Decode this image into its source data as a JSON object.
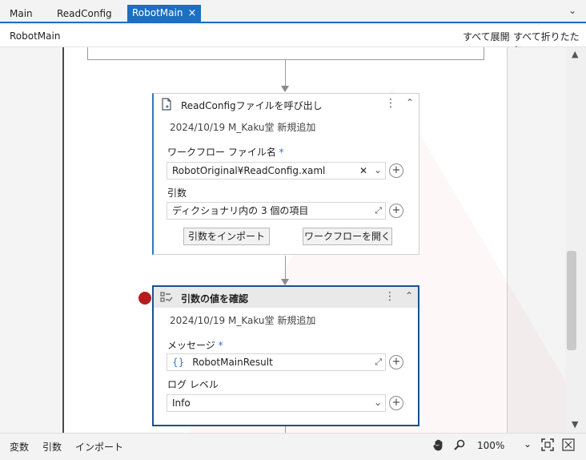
{
  "tabs": [
    {
      "label": "Main"
    },
    {
      "label": "ReadConfig"
    },
    {
      "label": "RobotMain",
      "close_icon": "×"
    }
  ],
  "tab_menu_icon": "⌄",
  "header": {
    "title": "RobotMain",
    "expand_all": "すべて展開",
    "collapse_all": "すべて折りたたむ"
  },
  "activity1": {
    "title": "ReadConfigファイルを呼び出し",
    "annotation": "2024/10/19 M_Kaku堂 新規追加",
    "workflow_label": "ワークフロー ファイル名",
    "required_mark": "*",
    "workflow_value": "RobotOriginal¥ReadConfig.xaml",
    "args_label": "引数",
    "args_value": "ディクショナリ内の 3 個の項目",
    "import_button": "引数をインポート",
    "open_button": "ワークフローを開く"
  },
  "activity2": {
    "title": "引数の値を確認",
    "annotation": "2024/10/19 M_Kaku堂 新規追加",
    "message_label": "メッセージ",
    "required_mark": "*",
    "message_prefix": "{}",
    "message_value": "RobotMainResult",
    "loglevel_label": "ログ レベル",
    "loglevel_value": "Info"
  },
  "icons": {
    "kebab": "⋮",
    "collapse": "⌃",
    "plus": "⊕",
    "clear": "✕",
    "dropdown": "⌄",
    "expand_editor": "⤢"
  },
  "bottom": {
    "variables": "変数",
    "arguments": "引数",
    "imports": "インポート",
    "zoom": "100%"
  },
  "colors": {
    "accent": "#1c6fc2",
    "selected_border": "#1d4f91",
    "breakpoint": "#b51d1d"
  }
}
